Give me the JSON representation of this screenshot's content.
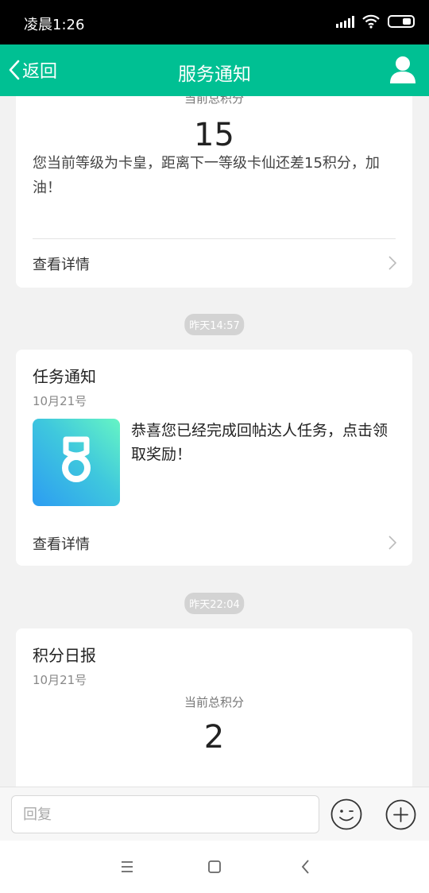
{
  "status_bar": {
    "time": "凌晨1:26"
  },
  "nav": {
    "back_label": "返回",
    "title": "服务通知"
  },
  "cards": [
    {
      "label": "当前总积分",
      "points": "15",
      "message": "您当前等级为卡皇，距离下一等级卡仙还差15积分，加油！",
      "detail_label": "查看详情"
    },
    {
      "title": "任务通知",
      "date": "10月21号",
      "message": "恭喜您已经完成回帖达人任务，点击领取奖励！",
      "detail_label": "查看详情"
    },
    {
      "title": "积分日报",
      "date": "10月21号",
      "label": "当前总积分",
      "points": "2"
    }
  ],
  "timestamps": [
    "昨天14:57",
    "昨天22:04"
  ],
  "input": {
    "placeholder": "回复"
  },
  "icons": {
    "back": "chevron-left-icon",
    "user": "user-icon",
    "medal": "medal-icon",
    "emoji": "smiley-icon",
    "plus": "plus-icon",
    "menu": "menu-icon",
    "home": "square-home-icon",
    "sys_back": "triangle-back-icon"
  },
  "colors": {
    "accent": "#00c093",
    "badge": "#d3d3d3"
  }
}
